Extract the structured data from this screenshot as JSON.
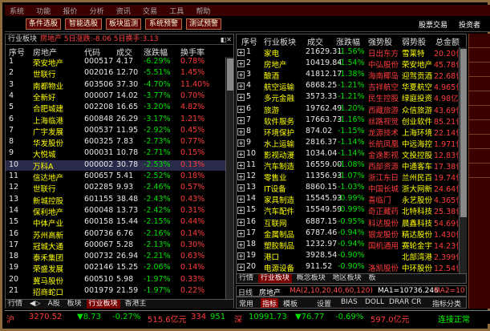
{
  "titlebar": {
    "items": [
      "系统",
      "功能",
      "报价",
      "分析",
      "资讯",
      "交易",
      "工具",
      "帮助"
    ]
  },
  "toolbar": {
    "buttons": [
      "条件选股",
      "智能选股",
      "板块监测",
      "系统预警",
      "测试预警"
    ],
    "right_text": "股票交易",
    "right_text2": "投资者"
  },
  "left": {
    "title_a": "行业板块",
    "title_b": "房地产 5日涨跌:-8.06 5日换手:3.13",
    "headers": [
      "序号",
      "房地产",
      "代码",
      "成交",
      "涨跌幅",
      "换手率"
    ],
    "rows": [
      [
        "1",
        "荣安地产",
        "000517",
        "4.17",
        "-6.29%",
        "0.78%"
      ],
      [
        "2",
        "世联行",
        "002016",
        "12.70",
        "-5.51%",
        "1.45%"
      ],
      [
        "3",
        "南都物业",
        "603506",
        "37.30",
        "-4.70%",
        "11.40%"
      ],
      [
        "4",
        "全新好",
        "000007",
        "14.02",
        "-3.77%",
        "0.70%"
      ],
      [
        "5",
        "合肥城建",
        "002208",
        "16.65",
        "-3.20%",
        "4.82%"
      ],
      [
        "6",
        "上海临港",
        "600848",
        "26.29",
        "-3.17%",
        "1.21%"
      ],
      [
        "7",
        "广宇发展",
        "000537",
        "11.95",
        "-2.92%",
        "0.45%"
      ],
      [
        "8",
        "华发股份",
        "600325",
        "7.83",
        "-2.73%",
        "0.77%"
      ],
      [
        "9",
        "大悦城",
        "000031",
        "10.78",
        "-2.71%",
        "0.15%"
      ],
      [
        "10",
        "万科A",
        "000002",
        "30.78",
        "-2.53%",
        "0.13%"
      ],
      [
        "11",
        "信达地产",
        "600657",
        "5.41",
        "-2.52%",
        "0.18%"
      ],
      [
        "12",
        "世联行",
        "002285",
        "9.93",
        "-2.46%",
        "0.57%"
      ],
      [
        "13",
        "新城控股",
        "601155",
        "38.48",
        "-2.43%",
        "0.43%"
      ],
      [
        "14",
        "保利地产",
        "600048",
        "13.73",
        "-2.42%",
        "0.31%"
      ],
      [
        "15",
        "中体产业",
        "600158",
        "15.44",
        "-2.15%",
        "0.44%"
      ],
      [
        "16",
        "苏州高新",
        "600736",
        "6.76",
        "-2.16%",
        "0.14%"
      ],
      [
        "17",
        "冠城大通",
        "600067",
        "5.28",
        "-2.13%",
        "0.30%"
      ],
      [
        "18",
        "泰禾集团",
        "000732",
        "26.94",
        "-2.21%",
        "0.63%"
      ],
      [
        "19",
        "荣盛发展",
        "002146",
        "15.25",
        "-2.06%",
        "0.14%"
      ],
      [
        "20",
        "冀马股份",
        "600510",
        "5.98",
        "-1.97%",
        "0.33%"
      ],
      [
        "21",
        "招商蛇口",
        "001979",
        "21.59",
        "-1.97%",
        "0.22%"
      ]
    ],
    "tabs": [
      "行情",
      "A股",
      "板块",
      "行业板块",
      "香港主"
    ]
  },
  "right": {
    "headers": [
      "序号",
      "行业板块",
      "成交",
      "涨跌幅",
      "强势股",
      "弱势股",
      "总金额"
    ],
    "rows": [
      [
        "1",
        "家电",
        "21629.31",
        "-1.56%",
        "日出东方",
        "雪莱特",
        "20.20亿"
      ],
      [
        "2",
        "房地产",
        "10419.84",
        "-1.54%",
        "中弘股份",
        "荣安地产",
        "45.78亿"
      ],
      [
        "3",
        "酿酒",
        "41812.17",
        "-1.38%",
        "海南椰岛",
        "迎驾贡酒",
        "22.68亿"
      ],
      [
        "4",
        "航空运输",
        "6868.25",
        "-1.21%",
        "吉祥航空",
        "华夏航空",
        "4.965亿"
      ],
      [
        "5",
        "多元金融",
        "3573.33",
        "-1.21%",
        "民生控股",
        "绿庭投资",
        "4.98亿"
      ],
      [
        "6",
        "旅游",
        "19762.49",
        "-1.20%",
        "西藏旅游",
        "众信旅游",
        "43.69亿"
      ],
      [
        "7",
        "软件服务",
        "17663.73",
        "-1.16%",
        "丝路视觉",
        "创业软件",
        "85.21亿"
      ],
      [
        "8",
        "环境保护",
        "874.02",
        "-1.15%",
        "龙源技术",
        "上海环境",
        "22.14亿"
      ],
      [
        "9",
        "水上运输",
        "2816.37",
        "-1.14%",
        "长航凤凰",
        "中远海控",
        "1.971亿"
      ],
      [
        "10",
        "影视动漫",
        "1034.04",
        "-1.14%",
        "金逸影视",
        "文投控股",
        "12.83亿"
      ],
      [
        "11",
        "汽车制造",
        "16559.00",
        "-1.08%",
        "西部资源",
        "中通客车",
        "17.38亿"
      ],
      [
        "12",
        "零售业",
        "11356.93",
        "-1.07%",
        "浙江东日",
        "兰州民百",
        "19.74亿"
      ],
      [
        "13",
        "IT设备",
        "8860.15",
        "-1.03%",
        "中国长城",
        "浙大网新",
        "24.64亿"
      ],
      [
        "14",
        "家具制造",
        "15545.93",
        "-0.99%",
        "喜临门",
        "永艺股份",
        "4.365亿"
      ],
      [
        "15",
        "汽车配件",
        "15549.59",
        "-0.99%",
        "奇正藏药",
        "北特科技",
        "25.38亿"
      ],
      [
        "16",
        "互联网",
        "6887.15",
        "-0.95%",
        "科达股份",
        "晨鑫科技",
        "54.69亿"
      ],
      [
        "17",
        "金属制品",
        "6787.46",
        "-0.94%",
        "银龙股份",
        "精达股份",
        "1.430亿"
      ],
      [
        "18",
        "塑胶制品",
        "1232.97",
        "-0.94%",
        "国机通用",
        "赛轮金宇",
        "14.23亿"
      ],
      [
        "19",
        "港口",
        "3928.54",
        "-0.90%",
        "",
        "北部湾港",
        "2.399亿"
      ],
      [
        "20",
        "电源设备",
        "911.52",
        "-0.90%",
        "洛凯股份",
        "中环股份",
        "12.54亿"
      ]
    ],
    "tabs": [
      "行情",
      "行业板块",
      "概念板块",
      "地区板块",
      "板"
    ]
  },
  "minipanel": {
    "label": "日线",
    "name": "房地产",
    "ma": "MA(2,10,20,40,60,120)",
    "ma1": "MA1=10736.246",
    "ma2": "MA2=10727"
  },
  "subbar": {
    "items": [
      "常用",
      "指标",
      "模板",
      "设置",
      "BIAS",
      "DOLL",
      "DRAR",
      "CR",
      "指标分类"
    ]
  },
  "status": {
    "items": [
      "沪",
      "3270.52",
      "▼8.73",
      "-0.27%",
      "515.6亿元",
      "334",
      "951",
      "深",
      "10991.73",
      "▼76.77",
      "-0.69%",
      "597.0亿元",
      "连接正常"
    ]
  }
}
